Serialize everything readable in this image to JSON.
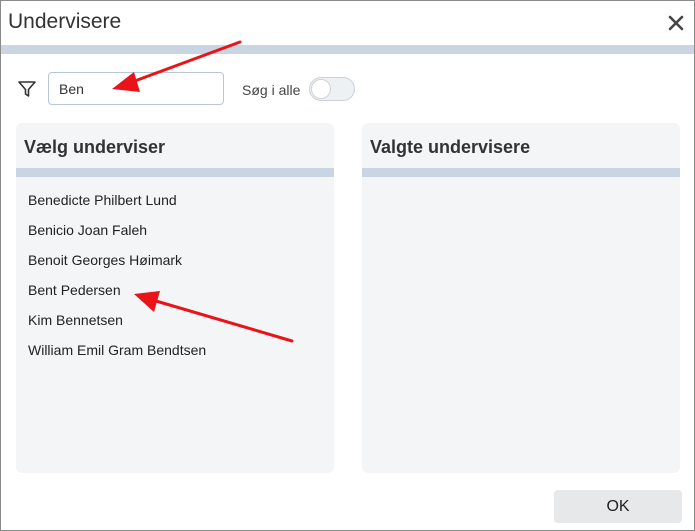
{
  "dialog": {
    "title": "Undervisere",
    "close_icon": "close-icon"
  },
  "filter": {
    "icon": "filter-icon",
    "search_value": "Ben",
    "search_all_label": "Søg i alle",
    "search_all_enabled": false
  },
  "available": {
    "title": "Vælg underviser",
    "items": [
      "Benedicte Philbert Lund",
      "Benicio Joan Faleh",
      "Benoit Georges Høimark",
      "Bent Pedersen",
      "Kim Bennetsen",
      "William Emil Gram Bendtsen"
    ]
  },
  "selected": {
    "title": "Valgte undervisere",
    "items": []
  },
  "footer": {
    "ok_label": "OK"
  },
  "colors": {
    "accent_bar": "#c9d5e2",
    "panel_bg": "#f4f5f6",
    "annotation_arrow": "#e8141a"
  }
}
